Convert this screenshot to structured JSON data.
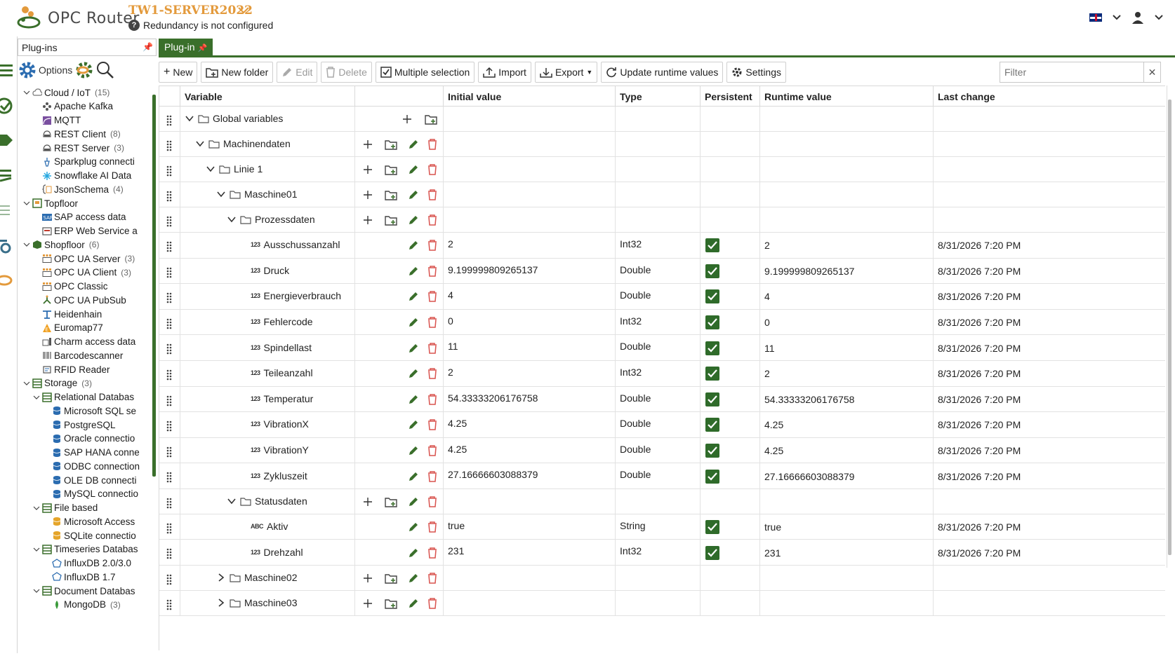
{
  "header": {
    "app_name": "OPC Router",
    "server_name": "TW1-SERVER2022",
    "redundancy_text": "Redundancy is not configured"
  },
  "left_panel": {
    "title": "Plug-ins",
    "options_label": "Options",
    "tree": [
      {
        "label": "Cloud / IoT",
        "count": "(15)",
        "level": 0,
        "expanded": true,
        "icon": "cloud-icon"
      },
      {
        "label": "Apache Kafka",
        "count": "",
        "level": 1,
        "icon": "kafka-icon"
      },
      {
        "label": "MQTT",
        "count": "",
        "level": 1,
        "icon": "mqtt-icon"
      },
      {
        "label": "REST Client",
        "count": "(8)",
        "level": 1,
        "icon": "rest-icon"
      },
      {
        "label": "REST Server",
        "count": "(3)",
        "level": 1,
        "icon": "rest-icon"
      },
      {
        "label": "Sparkplug connecti",
        "count": "",
        "level": 1,
        "icon": "sparkplug-icon"
      },
      {
        "label": "Snowflake AI Data",
        "count": "",
        "level": 1,
        "icon": "snowflake-icon"
      },
      {
        "label": "JsonSchema",
        "count": "(4)",
        "level": 1,
        "icon": "json-icon"
      },
      {
        "label": "Topfloor",
        "count": "",
        "level": 0,
        "expanded": true,
        "icon": "topfloor-icon"
      },
      {
        "label": "SAP access data",
        "count": "",
        "level": 1,
        "icon": "sap-icon"
      },
      {
        "label": "ERP Web Service a",
        "count": "",
        "level": 1,
        "icon": "erp-icon"
      },
      {
        "label": "Shopfloor",
        "count": "(6)",
        "level": 0,
        "expanded": true,
        "icon": "shopfloor-icon"
      },
      {
        "label": "OPC UA Server",
        "count": "(3)",
        "level": 1,
        "icon": "opc-icon"
      },
      {
        "label": "OPC UA Client",
        "count": "(3)",
        "level": 1,
        "icon": "opc-icon"
      },
      {
        "label": "OPC Classic",
        "count": "",
        "level": 1,
        "icon": "opc-icon"
      },
      {
        "label": "OPC UA PubSub",
        "count": "",
        "level": 1,
        "icon": "pubsub-icon"
      },
      {
        "label": "Heidenhain",
        "count": "",
        "level": 1,
        "icon": "heidenhain-icon"
      },
      {
        "label": "Euromap77",
        "count": "",
        "level": 1,
        "icon": "euromap-icon"
      },
      {
        "label": "Charm access data",
        "count": "",
        "level": 1,
        "icon": "charm-icon"
      },
      {
        "label": "Barcodescanner",
        "count": "",
        "level": 1,
        "icon": "barcode-icon"
      },
      {
        "label": "RFID Reader",
        "count": "",
        "level": 1,
        "icon": "rfid-icon"
      },
      {
        "label": "Storage",
        "count": "(3)",
        "level": 0,
        "expanded": true,
        "icon": "storage-icon"
      },
      {
        "label": "Relational Databas",
        "count": "",
        "level": 1,
        "expanded": true,
        "icon": "storage-icon"
      },
      {
        "label": "Microsoft SQL se",
        "count": "",
        "level": 2,
        "icon": "database-icon"
      },
      {
        "label": "PostgreSQL",
        "count": "",
        "level": 2,
        "icon": "database-icon"
      },
      {
        "label": "Oracle connectio",
        "count": "",
        "level": 2,
        "icon": "database-icon"
      },
      {
        "label": "SAP HANA conne",
        "count": "",
        "level": 2,
        "icon": "database-icon"
      },
      {
        "label": "ODBC connection",
        "count": "",
        "level": 2,
        "icon": "database-icon"
      },
      {
        "label": "OLE DB connecti",
        "count": "",
        "level": 2,
        "icon": "database-icon"
      },
      {
        "label": "MySQL connectio",
        "count": "",
        "level": 2,
        "icon": "database-icon"
      },
      {
        "label": "File based",
        "count": "",
        "level": 1,
        "expanded": true,
        "icon": "storage-icon"
      },
      {
        "label": "Microsoft Access",
        "count": "",
        "level": 2,
        "icon": "database-yellow-icon"
      },
      {
        "label": "SQLite connectio",
        "count": "",
        "level": 2,
        "icon": "database-yellow-icon"
      },
      {
        "label": "Timeseries Databas",
        "count": "",
        "level": 1,
        "expanded": true,
        "icon": "storage-icon"
      },
      {
        "label": "InfluxDB 2.0/3.0",
        "count": "",
        "level": 2,
        "icon": "influx-icon"
      },
      {
        "label": "InfluxDB 1.7",
        "count": "",
        "level": 2,
        "icon": "influx-icon"
      },
      {
        "label": "Document Databas",
        "count": "",
        "level": 1,
        "expanded": true,
        "icon": "storage-icon"
      },
      {
        "label": "MongoDB",
        "count": "(3)",
        "level": 2,
        "icon": "mongodb-icon"
      }
    ]
  },
  "tab": {
    "label": "Plug-in"
  },
  "toolbar": {
    "new": "New",
    "new_folder": "New folder",
    "edit": "Edit",
    "delete": "Delete",
    "multiple_selection": "Multiple selection",
    "import": "Import",
    "export": "Export",
    "update_runtime": "Update runtime values",
    "settings": "Settings",
    "filter_placeholder": "Filter"
  },
  "grid": {
    "columns": [
      "Variable",
      "",
      "Initial value",
      "Type",
      "Persistent",
      "Runtime value",
      "Last change"
    ],
    "rows": [
      {
        "name": "Global variables",
        "kind": "folder",
        "depth": 0,
        "expanded": true,
        "add": true,
        "edit": false,
        "initial": "",
        "type": "",
        "persistent": false,
        "runtime": "",
        "last": ""
      },
      {
        "name": "Machinendaten",
        "kind": "folder",
        "depth": 1,
        "expanded": true,
        "add": true,
        "edit": true,
        "initial": "",
        "type": "",
        "persistent": false,
        "runtime": "",
        "last": ""
      },
      {
        "name": "Linie 1",
        "kind": "folder",
        "depth": 2,
        "expanded": true,
        "add": true,
        "edit": true,
        "initial": "",
        "type": "",
        "persistent": false,
        "runtime": "",
        "last": ""
      },
      {
        "name": "Maschine01",
        "kind": "folder",
        "depth": 3,
        "expanded": true,
        "add": true,
        "edit": true,
        "initial": "",
        "type": "",
        "persistent": false,
        "runtime": "",
        "last": ""
      },
      {
        "name": "Prozessdaten",
        "kind": "folder",
        "depth": 4,
        "expanded": true,
        "add": true,
        "edit": true,
        "initial": "",
        "type": "",
        "persistent": false,
        "runtime": "",
        "last": ""
      },
      {
        "name": "Ausschussanzahl",
        "kind": "num",
        "depth": 5,
        "initial": "2",
        "type": "Int32",
        "persistent": true,
        "runtime": "2",
        "last": "8/31/2026 7:20 PM"
      },
      {
        "name": "Druck",
        "kind": "num",
        "depth": 5,
        "initial": "9.199999809265137",
        "type": "Double",
        "persistent": true,
        "runtime": "9.199999809265137",
        "last": "8/31/2026 7:20 PM"
      },
      {
        "name": "Energieverbrauch",
        "kind": "num",
        "depth": 5,
        "initial": "4",
        "type": "Double",
        "persistent": true,
        "runtime": "4",
        "last": "8/31/2026 7:20 PM"
      },
      {
        "name": "Fehlercode",
        "kind": "num",
        "depth": 5,
        "initial": "0",
        "type": "Int32",
        "persistent": true,
        "runtime": "0",
        "last": "8/31/2026 7:20 PM"
      },
      {
        "name": "Spindellast",
        "kind": "num",
        "depth": 5,
        "initial": "11",
        "type": "Double",
        "persistent": true,
        "runtime": "11",
        "last": "8/31/2026 7:20 PM"
      },
      {
        "name": "Teileanzahl",
        "kind": "num",
        "depth": 5,
        "initial": "2",
        "type": "Int32",
        "persistent": true,
        "runtime": "2",
        "last": "8/31/2026 7:20 PM"
      },
      {
        "name": "Temperatur",
        "kind": "num",
        "depth": 5,
        "initial": "54.33333206176758",
        "type": "Double",
        "persistent": true,
        "runtime": "54.33333206176758",
        "last": "8/31/2026 7:20 PM"
      },
      {
        "name": "VibrationX",
        "kind": "num",
        "depth": 5,
        "initial": "4.25",
        "type": "Double",
        "persistent": true,
        "runtime": "4.25",
        "last": "8/31/2026 7:20 PM"
      },
      {
        "name": "VibrationY",
        "kind": "num",
        "depth": 5,
        "initial": "4.25",
        "type": "Double",
        "persistent": true,
        "runtime": "4.25",
        "last": "8/31/2026 7:20 PM"
      },
      {
        "name": "Zykluszeit",
        "kind": "num",
        "depth": 5,
        "initial": "27.16666603088379",
        "type": "Double",
        "persistent": true,
        "runtime": "27.16666603088379",
        "last": "8/31/2026 7:20 PM"
      },
      {
        "name": "Statusdaten",
        "kind": "folder",
        "depth": 4,
        "expanded": true,
        "add": true,
        "edit": true,
        "initial": "",
        "type": "",
        "persistent": false,
        "runtime": "",
        "last": ""
      },
      {
        "name": "Aktiv",
        "kind": "str",
        "depth": 5,
        "initial": "true",
        "type": "String",
        "persistent": true,
        "runtime": "true",
        "last": "8/31/2026 7:20 PM"
      },
      {
        "name": "Drehzahl",
        "kind": "num",
        "depth": 5,
        "initial": "231",
        "type": "Int32",
        "persistent": true,
        "runtime": "231",
        "last": "8/31/2026 7:20 PM"
      },
      {
        "name": "Maschine02",
        "kind": "folder",
        "depth": 3,
        "expanded": false,
        "add": true,
        "edit": true,
        "initial": "",
        "type": "",
        "persistent": false,
        "runtime": "",
        "last": ""
      },
      {
        "name": "Maschine03",
        "kind": "folder",
        "depth": 3,
        "expanded": false,
        "add": true,
        "edit": true,
        "initial": "",
        "type": "",
        "persistent": false,
        "runtime": "",
        "last": ""
      }
    ]
  },
  "colors": {
    "accent_green": "#3a6f2b",
    "brand_orange": "#e39a3c",
    "delete_red": "#d9534f",
    "check_green": "#2f6b2a"
  }
}
